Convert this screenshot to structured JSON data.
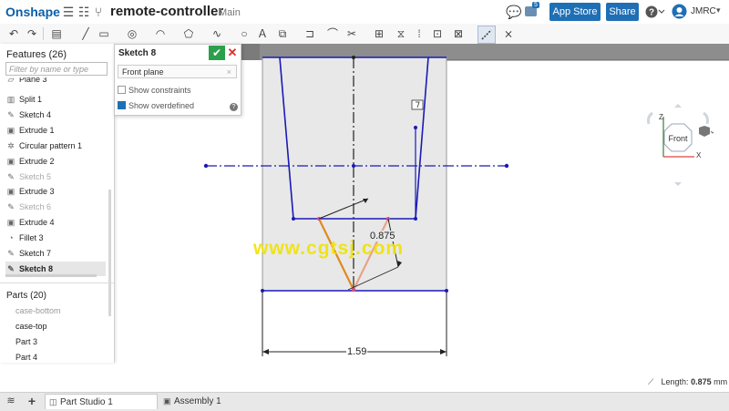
{
  "topbar": {
    "logo": "Onshape",
    "document_title": "remote-controller",
    "branch": "Main",
    "notifications_badge": "5",
    "app_store_label": "App Store",
    "share_label": "Share",
    "user_name": "JMRC"
  },
  "toolbar": {
    "icons": [
      "undo-icon",
      "redo-icon",
      "sketch-icon",
      "line-icon",
      "rectangle-icon",
      "circle-icon",
      "arc-icon",
      "polygon-icon",
      "spline-icon",
      "point-icon",
      "text-icon",
      "construction-icon",
      "fillet-icon",
      "trim-icon",
      "offset-icon",
      "mirror-icon",
      "pattern-icon",
      "dimension-icon",
      "pattern-tool-icon"
    ]
  },
  "features": {
    "title": "Features (26)",
    "filter_placeholder": "Filter by name or type",
    "items": [
      {
        "label": "Plane 3",
        "icon": "plane-icon",
        "state": "normal"
      },
      {
        "label": "Split 1",
        "icon": "split-icon",
        "state": "normal"
      },
      {
        "label": "Sketch 4",
        "icon": "sketch-icon",
        "state": "normal"
      },
      {
        "label": "Extrude 1",
        "icon": "extrude-icon",
        "state": "normal"
      },
      {
        "label": "Circular pattern 1",
        "icon": "pattern-icon",
        "state": "normal"
      },
      {
        "label": "Extrude 2",
        "icon": "extrude-icon",
        "state": "normal"
      },
      {
        "label": "Sketch 5",
        "icon": "sketch-icon",
        "state": "dim"
      },
      {
        "label": "Extrude 3",
        "icon": "extrude-icon",
        "state": "normal"
      },
      {
        "label": "Sketch 6",
        "icon": "sketch-icon",
        "state": "dim"
      },
      {
        "label": "Extrude 4",
        "icon": "extrude-icon",
        "state": "normal"
      },
      {
        "label": "Fillet 3",
        "icon": "fillet-icon",
        "state": "normal"
      },
      {
        "label": "Sketch 7",
        "icon": "sketch-icon",
        "state": "normal"
      },
      {
        "label": "Sketch 8",
        "icon": "sketch-icon",
        "state": "selected"
      }
    ]
  },
  "parts": {
    "title": "Parts (20)",
    "items": [
      {
        "label": "case-bottom",
        "state": "dim"
      },
      {
        "label": "case-top",
        "state": "normal"
      },
      {
        "label": "Part 3",
        "state": "normal"
      },
      {
        "label": "Part 4",
        "state": "normal"
      }
    ]
  },
  "sketch_dialog": {
    "title": "Sketch 8",
    "plane_value": "Front plane",
    "show_constraints_label": "Show constraints",
    "show_constraints_checked": false,
    "show_overdefined_label": "Show overdefined",
    "show_overdefined_checked": true
  },
  "sketch": {
    "dimension_angle_value": "0.875",
    "dimension_width_value": "1.59"
  },
  "viewcube": {
    "face_label": "Front",
    "axis_z": "Z",
    "axis_x": "X"
  },
  "watermark": "www.cgtsj.com",
  "status": {
    "length_label": "Length:",
    "length_value": "0.875",
    "length_unit": "mm"
  },
  "tabs": [
    {
      "label": "Part Studio 1",
      "active": true
    },
    {
      "label": "Assembly 1",
      "active": false
    }
  ],
  "colors": {
    "accent_blue": "#1f6fb5",
    "sketch_blue": "#1a1ab8",
    "sketch_orange": "#e08a20",
    "part_fill": "#e8e8e8",
    "ok_green": "#2aa04a"
  }
}
